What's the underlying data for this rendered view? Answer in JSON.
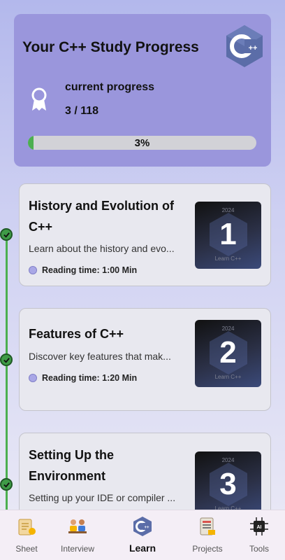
{
  "progress": {
    "title": "Your C++ Study Progress",
    "label": "current progress",
    "count": "3 / 118",
    "percent_text": "3%",
    "fraction": 0.0254,
    "logo_icon": "cpp-logo-icon",
    "badge_icon": "award-ribbon-icon"
  },
  "lessons": [
    {
      "title": "History and Evolution of C++",
      "description": "Learn about the history and evo...",
      "reading": "Reading time: 1:00 Min",
      "number": "1",
      "year": "2024",
      "thumb_label": "Learn C++",
      "completed": true
    },
    {
      "title": "Features of C++",
      "description": "Discover key features that mak...",
      "reading": "Reading time: 1:20 Min",
      "number": "2",
      "year": "2024",
      "thumb_label": "Learn C++",
      "completed": true
    },
    {
      "title": "Setting Up the Environment",
      "description": "Setting up your IDE or compiler ...",
      "reading": "",
      "number": "3",
      "year": "2024",
      "thumb_label": "Learn C++",
      "completed": true
    }
  ],
  "nav": {
    "items": [
      {
        "label": "Sheet",
        "icon": "sheet-icon"
      },
      {
        "label": "Interview",
        "icon": "interview-icon"
      },
      {
        "label": "Learn",
        "icon": "cpp-logo-icon",
        "active": true
      },
      {
        "label": "Projects",
        "icon": "projects-icon"
      },
      {
        "label": "Tools",
        "icon": "ai-chip-icon"
      }
    ]
  },
  "colors": {
    "accent": "#4caf50",
    "card": "#9a96dc",
    "cpp_blue": "#5b6da8"
  }
}
